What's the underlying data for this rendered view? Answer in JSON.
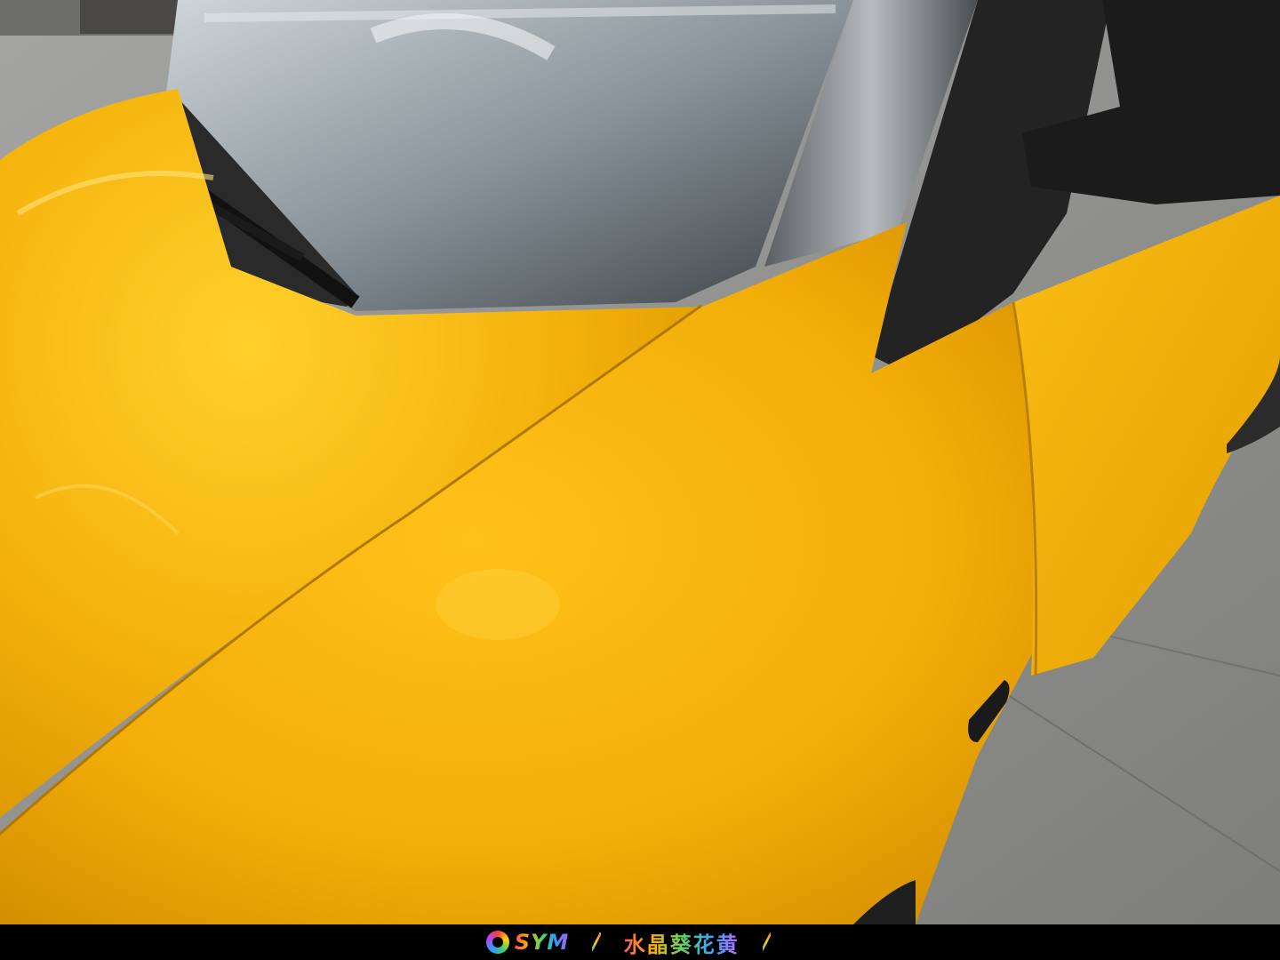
{
  "caption": {
    "brand": "SYM",
    "separator": "/",
    "product_name": "水晶葵花黄",
    "trailing_separator": "/"
  },
  "colors": {
    "paint_yellow": "#f4b40e",
    "paint_highlight": "#ffd33a",
    "paint_shadow": "#c98900",
    "trim_black": "#1c1c1c",
    "ground_gray": "#8e8e8c",
    "caption_bg": "#000000"
  },
  "scene": {
    "subject": "yellow-car-front-fender-and-hood"
  }
}
